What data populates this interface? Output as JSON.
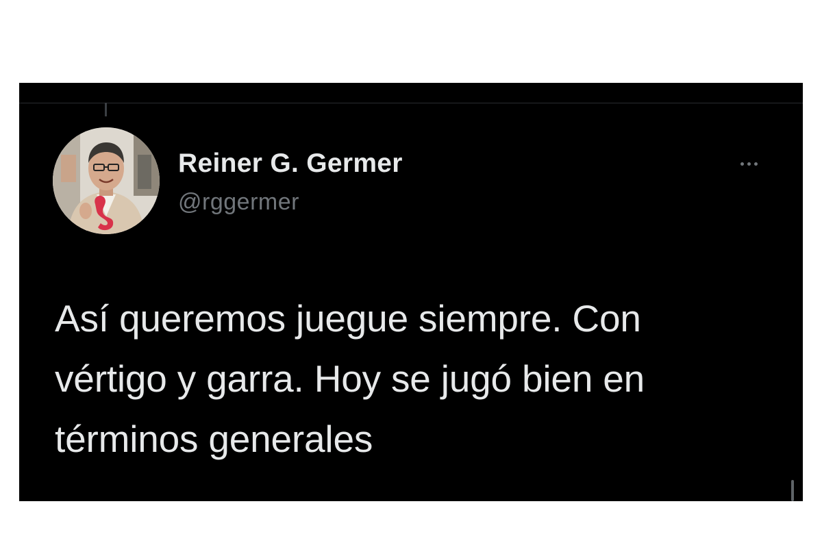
{
  "author": {
    "display_name": "Reiner G. Germer",
    "handle": "@rggermer",
    "avatar_icon": "profile-photo"
  },
  "tweet": {
    "lines": [
      "Así queremos juegue siempre. Con",
      "vértigo y garra. Hoy se jugó bien en",
      "términos generales"
    ]
  },
  "actions": {
    "more_icon": "more-horizontal-icon"
  },
  "colors": {
    "background": "#000000",
    "primary_text": "#e7e9ea",
    "secondary_text": "#71767b",
    "page_background": "#ffffff"
  }
}
